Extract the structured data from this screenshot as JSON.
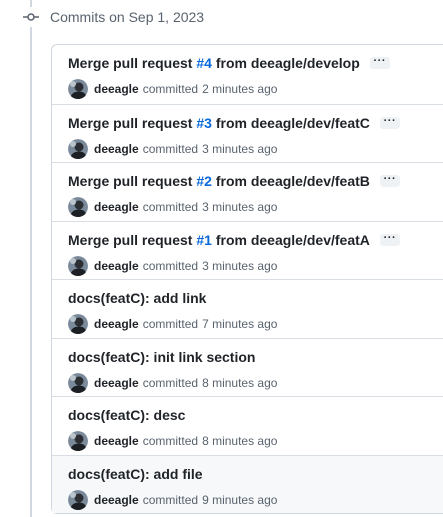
{
  "date_header": {
    "label": "Commits on Sep 1, 2023"
  },
  "icons": {
    "commit": "git-commit-icon",
    "ellipsis": "ellipsis-icon",
    "avatar": "avatar"
  },
  "commits": [
    {
      "title_prefix": "Merge pull request ",
      "pr_number": "#4",
      "title_suffix": " from deeagle/develop",
      "has_ellipsis": true,
      "author": "deeagle",
      "committed": "committed",
      "time_ago": "2 minutes ago"
    },
    {
      "title_prefix": "Merge pull request ",
      "pr_number": "#3",
      "title_suffix": " from deeagle/dev/featC",
      "has_ellipsis": true,
      "author": "deeagle",
      "committed": "committed",
      "time_ago": "3 minutes ago"
    },
    {
      "title_prefix": "Merge pull request ",
      "pr_number": "#2",
      "title_suffix": " from deeagle/dev/featB",
      "has_ellipsis": true,
      "author": "deeagle",
      "committed": "committed",
      "time_ago": "3 minutes ago"
    },
    {
      "title_prefix": "Merge pull request ",
      "pr_number": "#1",
      "title_suffix": " from deeagle/dev/featA",
      "has_ellipsis": true,
      "author": "deeagle",
      "committed": "committed",
      "time_ago": "3 minutes ago"
    },
    {
      "title_prefix": "docs(featC): add link",
      "pr_number": "",
      "title_suffix": "",
      "has_ellipsis": false,
      "author": "deeagle",
      "committed": "committed",
      "time_ago": "7 minutes ago"
    },
    {
      "title_prefix": "docs(featC): init link section",
      "pr_number": "",
      "title_suffix": "",
      "has_ellipsis": false,
      "author": "deeagle",
      "committed": "committed",
      "time_ago": "8 minutes ago"
    },
    {
      "title_prefix": "docs(featC): desc",
      "pr_number": "",
      "title_suffix": "",
      "has_ellipsis": false,
      "author": "deeagle",
      "committed": "committed",
      "time_ago": "8 minutes ago"
    },
    {
      "title_prefix": "docs(featC): add file",
      "pr_number": "",
      "title_suffix": "",
      "has_ellipsis": false,
      "author": "deeagle",
      "committed": "committed",
      "time_ago": "9 minutes ago",
      "hovered": true
    }
  ],
  "colors": {
    "link": "#0969da",
    "muted": "#59636e",
    "border": "#d0d7de",
    "hover_bg": "#f6f8fa"
  }
}
